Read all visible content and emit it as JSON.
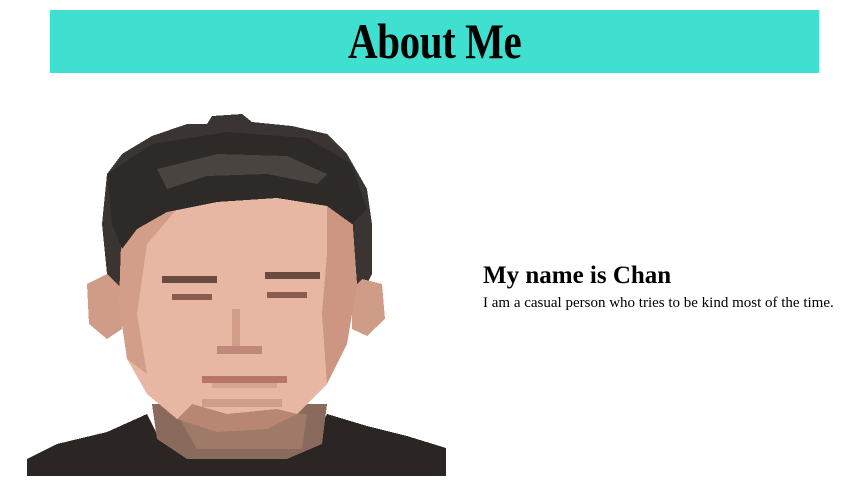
{
  "header": {
    "title": "About Me",
    "background_color": "#40e0d0"
  },
  "profile": {
    "heading": "My name is Chan",
    "description": "I am a casual person who tries to be kind most of the time.",
    "avatar_icon": "pixel-art-portrait"
  }
}
